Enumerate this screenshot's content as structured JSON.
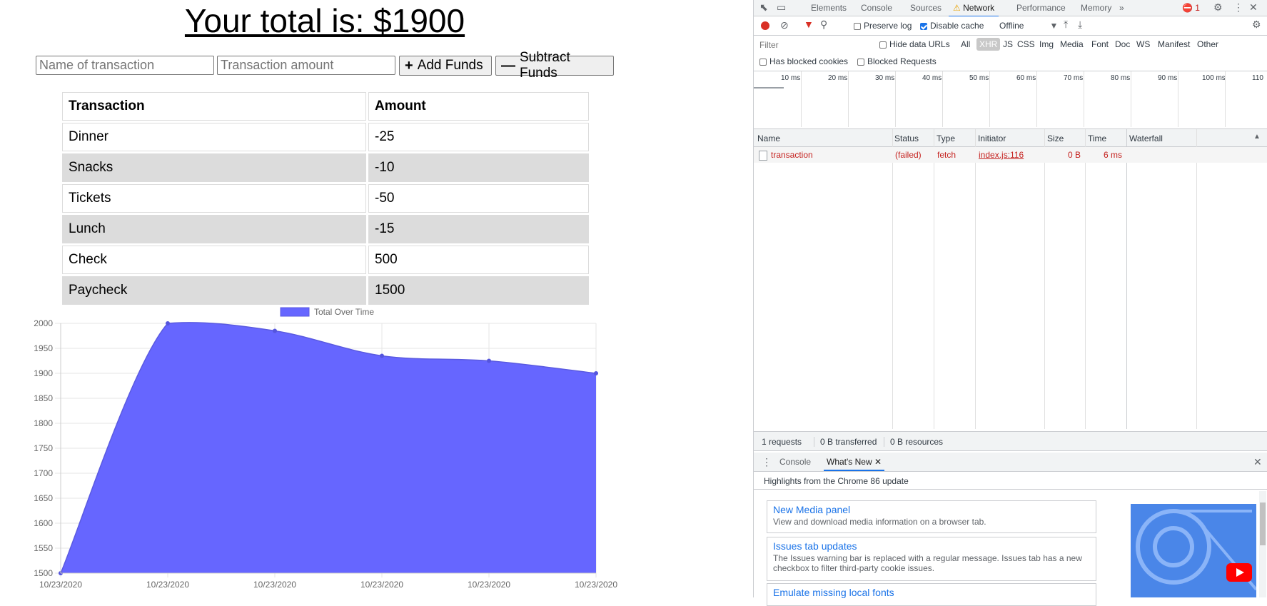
{
  "app": {
    "total_text": "Your total is: $1900",
    "name_placeholder": "Name of transaction",
    "amount_placeholder": "Transaction amount",
    "add_label": "Add Funds",
    "subtract_label": "Subtract Funds",
    "table_headers": [
      "Transaction",
      "Amount"
    ],
    "transactions": [
      {
        "name": "Dinner",
        "amount": "-25"
      },
      {
        "name": "Snacks",
        "amount": "-10"
      },
      {
        "name": "Tickets",
        "amount": "-50"
      },
      {
        "name": "Lunch",
        "amount": "-15"
      },
      {
        "name": "Check",
        "amount": "500"
      },
      {
        "name": "Paycheck",
        "amount": "1500"
      }
    ]
  },
  "chart_data": {
    "type": "area",
    "x": [
      "10/23/2020",
      "10/23/2020",
      "10/23/2020",
      "10/23/2020",
      "10/23/2020",
      "10/23/2020"
    ],
    "series": [
      {
        "name": "Total Over Time",
        "values": [
          1500,
          2000,
          1985,
          1935,
          1925,
          1900
        ],
        "color": "#6666ff"
      }
    ],
    "yticks": [
      2000,
      1950,
      1900,
      1850,
      1800,
      1750,
      1700,
      1650,
      1600,
      1550,
      1500
    ],
    "ylim": [
      1500,
      2000
    ],
    "grid": true,
    "legend": "top-center"
  },
  "devtools": {
    "tabs": [
      "Elements",
      "Console",
      "Sources",
      "Network",
      "Performance",
      "Memory"
    ],
    "active_tab": "Network",
    "more_tabs": "»",
    "error_count": "1",
    "preserve_log": "Preserve log",
    "disable_cache": "Disable cache",
    "throttle": "Offline",
    "filter_placeholder": "Filter",
    "hide_data_urls": "Hide data URLs",
    "filter_types": [
      "All",
      "XHR",
      "JS",
      "CSS",
      "Img",
      "Media",
      "Font",
      "Doc",
      "WS",
      "Manifest",
      "Other"
    ],
    "selected_type": "XHR",
    "has_blocked_cookies": "Has blocked cookies",
    "blocked_requests": "Blocked Requests",
    "timeline_ticks": [
      "10 ms",
      "20 ms",
      "30 ms",
      "40 ms",
      "50 ms",
      "60 ms",
      "70 ms",
      "80 ms",
      "90 ms",
      "100 ms",
      "110"
    ],
    "columns": [
      "Name",
      "Status",
      "Type",
      "Initiator",
      "Size",
      "Time",
      "Waterfall"
    ],
    "request": {
      "name": "transaction",
      "status": "(failed)",
      "type": "fetch",
      "initiator": "index.js:116",
      "size": "0 B",
      "time": "6 ms"
    },
    "summary": [
      "1 requests",
      "0 B transferred",
      "0 B resources"
    ],
    "drawer_tabs": [
      "Console",
      "What's New"
    ],
    "drawer_heading": "Highlights from the Chrome 86 update",
    "news": [
      {
        "title": "New Media panel",
        "desc": "View and download media information on a browser tab."
      },
      {
        "title": "Issues tab updates",
        "desc": "The Issues warning bar is replaced with a regular message. Issues tab has a new checkbox to filter third-party cookie issues."
      },
      {
        "title": "Emulate missing local fonts",
        "desc": ""
      }
    ]
  }
}
